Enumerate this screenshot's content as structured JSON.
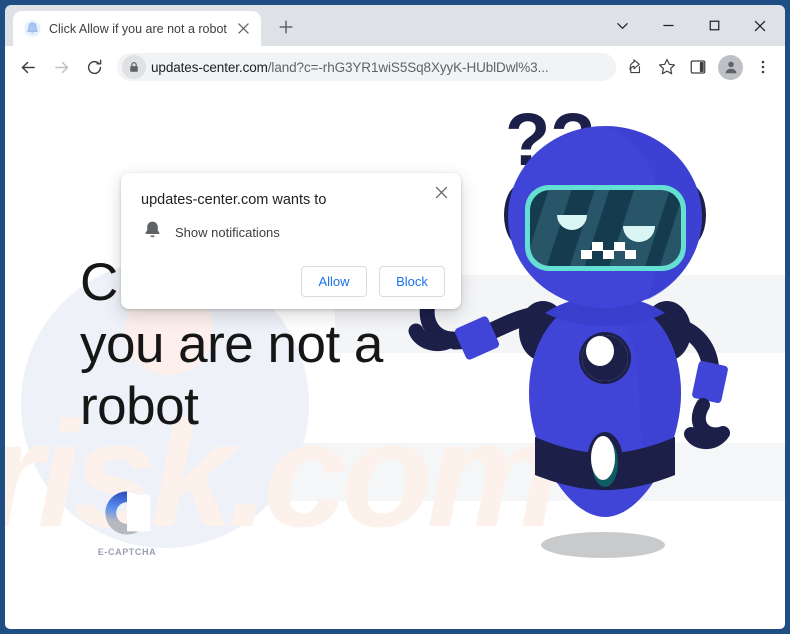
{
  "window": {
    "controls": {
      "tab_search": "tab-search-chevron",
      "minimize": "minimize",
      "maximize": "maximize",
      "close": "close"
    }
  },
  "tabstrip": {
    "active_tab": {
      "title": "Click Allow if you are not a robot",
      "favicon": "bell-favicon",
      "close_label": "×"
    },
    "new_tab_label": "+"
  },
  "toolbar": {
    "back_label": "←",
    "forward_label": "→",
    "reload_label": "↻",
    "url_host": "updates-center.com",
    "url_path": "/land?c=-rhG3YR1wiS5Sq8XyyK-HUblDwl%3...",
    "url_full": "updates-center.com/land?c=-rhG3YR1wiS5Sq8XyyK-HUblDwl%3...",
    "site_info_icon": "lock-icon",
    "share_icon": "share-icon",
    "bookmark_icon": "star-icon",
    "side_panel_icon": "side-panel-icon",
    "profile_icon": "person-avatar-icon",
    "menu_icon": "three-dot-menu-icon"
  },
  "dialog": {
    "title": "updates-center.com wants to",
    "permission_icon": "bell-icon",
    "permission_label": "Show notifications",
    "allow_label": "Allow",
    "block_label": "Block",
    "close_label": "✕"
  },
  "page": {
    "headline": "Click Allow if you are not a robot",
    "watermark": "risk.com",
    "logo_label": "E-CAPTCHA",
    "robot_alt": "confused-robot-illustration",
    "question_marks": "??"
  },
  "colors": {
    "frame": "#1f4e85",
    "tabstrip": "#dee1e6",
    "omnibox": "#f1f3f4",
    "link_blue": "#1a73e8",
    "robot_blue": "#4045d8",
    "robot_dark": "#1c1f48",
    "visor_cyan": "#63e0d2",
    "watermark": "#fdf1ec",
    "logo_blue_dark": "#2b4bbd",
    "logo_blue_light": "#5b8def",
    "logo_gray": "#b5b8bd"
  }
}
